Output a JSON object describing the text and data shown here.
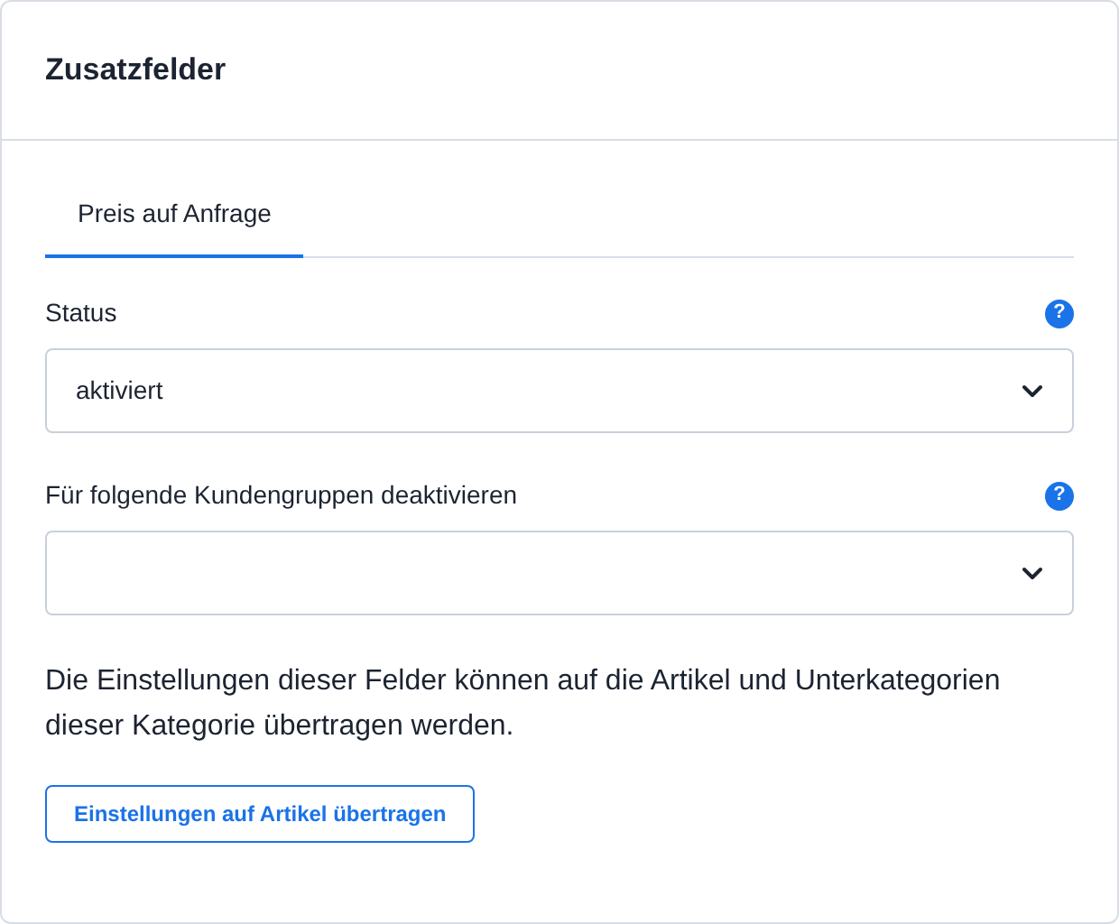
{
  "card": {
    "title": "Zusatzfelder"
  },
  "tabs": [
    {
      "label": "Preis auf Anfrage",
      "selected": true
    }
  ],
  "fields": [
    {
      "label": "Status",
      "help": "?",
      "value": "aktiviert"
    },
    {
      "label": "Für folgende Kundengruppen deaktivieren",
      "help": "?"
    }
  ],
  "description": "Die Einstellungen dieser Felder können auf die Artikel und Unterkategorien dieser Kategorie übertragen werden.",
  "button": {
    "label": "Einstellungen auf Artikel übertragen"
  }
}
